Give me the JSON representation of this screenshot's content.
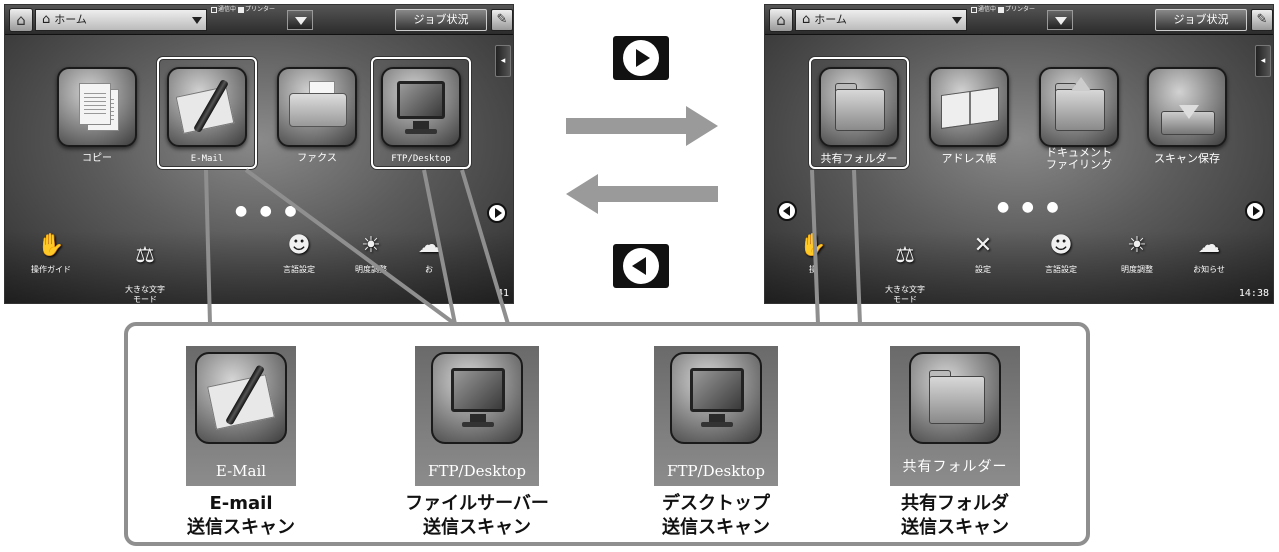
{
  "topbar": {
    "breadcrumb": "ホーム",
    "status_comm": "通信中",
    "status_printer": "プリンター",
    "job_status": "ジョブ状況"
  },
  "left_screen": {
    "apps": [
      {
        "label": "コピー"
      },
      {
        "label": "E-Mail"
      },
      {
        "label": "ファクス"
      },
      {
        "label": "FTP/Desktop"
      }
    ],
    "pager": "● ● ●",
    "tools": [
      {
        "label": "操作ガイド"
      },
      {
        "label": "大きな文字\nモード"
      },
      {
        "label": "言語設定"
      },
      {
        "label": "明度調整"
      },
      {
        "label": "お"
      }
    ],
    "clock": "41"
  },
  "right_screen": {
    "apps": [
      {
        "label": "共有フォルダー"
      },
      {
        "label": "アドレス帳"
      },
      {
        "label": "ドキュメント\nファイリング"
      },
      {
        "label": "スキャン保存"
      }
    ],
    "pager": "● ● ●",
    "tools": [
      {
        "label": "操"
      },
      {
        "label": "大きな文字\nモード"
      },
      {
        "label": "設定"
      },
      {
        "label": "言語設定"
      },
      {
        "label": "明度調整"
      },
      {
        "label": "お知らせ"
      }
    ],
    "clock": "14:38"
  },
  "callout": {
    "items": [
      {
        "caption": "E-Mail",
        "title_line1": "E-mail",
        "title_line2": "送信スキャン"
      },
      {
        "caption": "FTP/Desktop",
        "title_line1": "ファイルサーバー",
        "title_line2": "送信スキャン"
      },
      {
        "caption": "FTP/Desktop",
        "title_line1": "デスクトップ",
        "title_line2": "送信スキャン"
      },
      {
        "caption": "共有フォルダー",
        "title_line1": "共有フォルダ",
        "title_line2": "送信スキャン"
      }
    ]
  },
  "colors": {
    "arrow": "#9a9a9a",
    "callout_border": "#8f8f8f",
    "button_bg": "#111111"
  }
}
